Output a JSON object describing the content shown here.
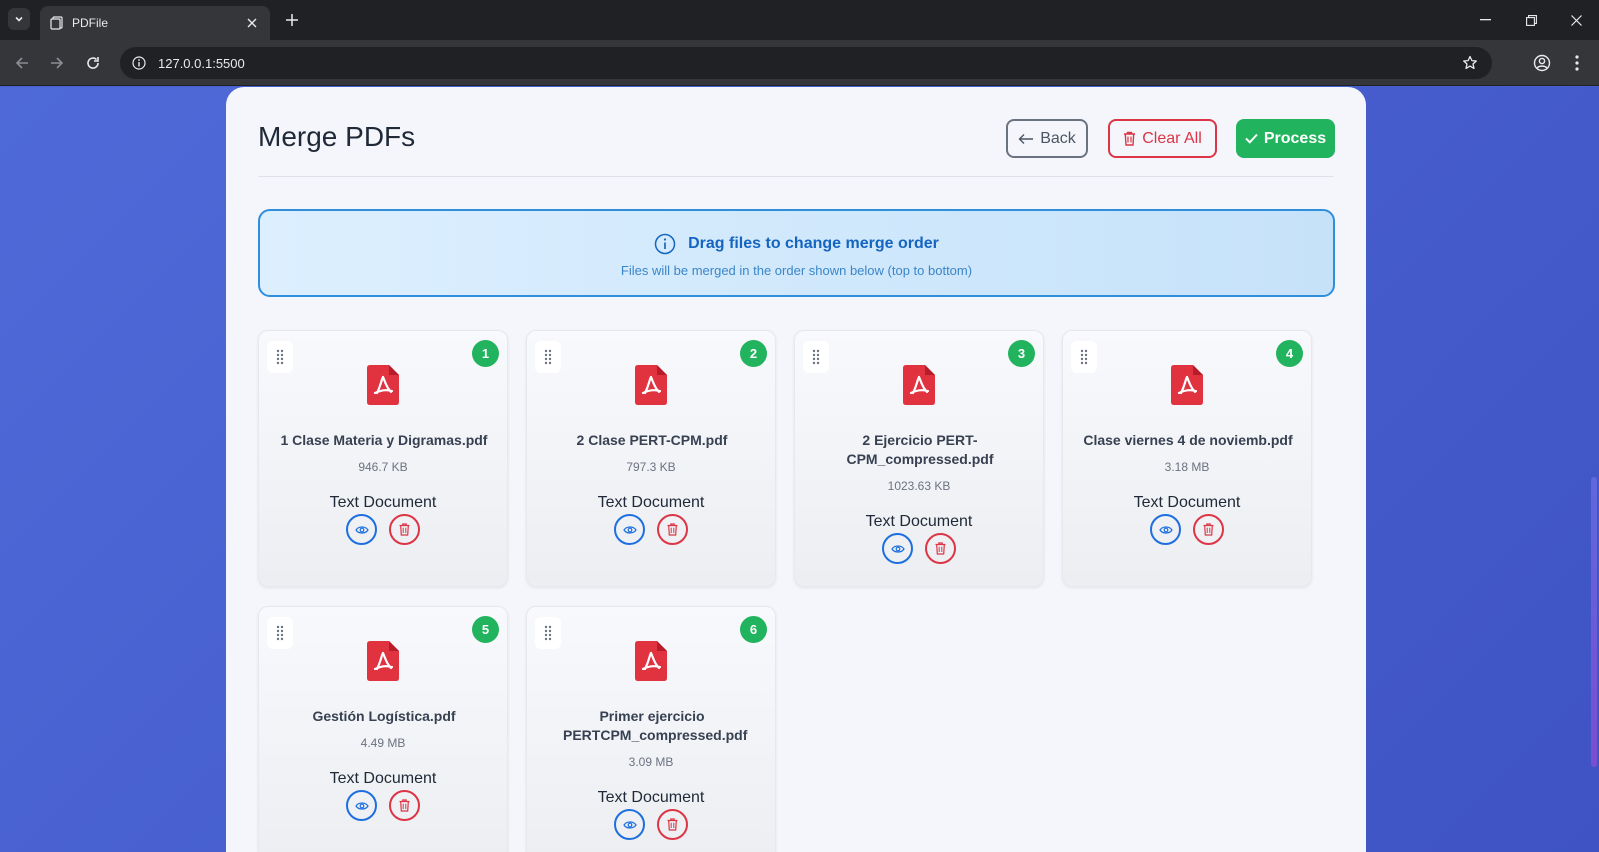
{
  "browser": {
    "tab_title": "PDFile",
    "url": "127.0.0.1:5500"
  },
  "page": {
    "title": "Merge PDFs",
    "buttons": {
      "back": "Back",
      "clear_all": "Clear All",
      "process": "Process"
    },
    "info": {
      "heading": "Drag files to change merge order",
      "subtext": "Files will be merged in the order shown below (top to bottom)"
    }
  },
  "files": [
    {
      "order": "1",
      "name": "1 Clase Materia y Digramas.pdf",
      "size": "946.7 KB",
      "type": "Text Document"
    },
    {
      "order": "2",
      "name": "2 Clase PERT-CPM.pdf",
      "size": "797.3 KB",
      "type": "Text Document"
    },
    {
      "order": "3",
      "name": "2 Ejercicio PERT-CPM_compressed.pdf",
      "size": "1023.63 KB",
      "type": "Text Document"
    },
    {
      "order": "4",
      "name": "Clase viernes 4 de noviemb.pdf",
      "size": "3.18 MB",
      "type": "Text Document"
    },
    {
      "order": "5",
      "name": "Gestión Logística.pdf",
      "size": "4.49 MB",
      "type": "Text Document"
    },
    {
      "order": "6",
      "name": "Primer ejercicio PERTCPM_compressed.pdf",
      "size": "3.09 MB",
      "type": "Text Document"
    }
  ],
  "colors": {
    "accent_green": "#22b35e",
    "danger_red": "#dc3545",
    "info_blue": "#1565c0",
    "pdf_red": "#e0323f"
  }
}
